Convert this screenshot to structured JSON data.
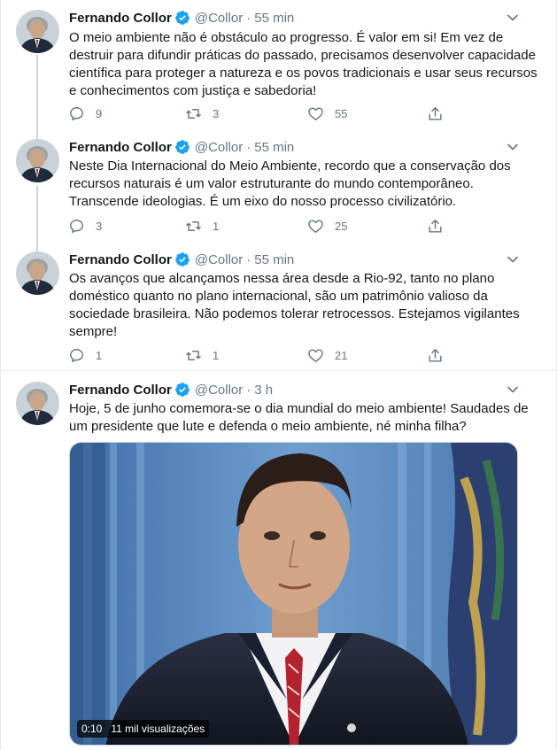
{
  "tweets": [
    {
      "name": "Fernando Collor",
      "handle": "@Collor",
      "dot": "·",
      "time": "55 min",
      "text": "O meio ambiente não é obstáculo ao progresso. É valor em si! Em vez de destruir para difundir práticas do passado, precisamos desenvolver capacidade científica para proteger a natureza e os povos tradicionais e usar seus recursos e conhecimentos com justiça e sabedoria!",
      "replies": "9",
      "retweets": "3",
      "likes": "55"
    },
    {
      "name": "Fernando Collor",
      "handle": "@Collor",
      "dot": "·",
      "time": "55 min",
      "text": "Neste Dia Internacional do Meio Ambiente, recordo que a conservação dos recursos naturais é um valor estruturante do mundo contemporâneo. Transcende ideologias. É um eixo do nosso processo civilizatório.",
      "replies": "3",
      "retweets": "1",
      "likes": "25"
    },
    {
      "name": "Fernando Collor",
      "handle": "@Collor",
      "dot": "·",
      "time": "55 min",
      "text": "Os avanços que alcançamos nessa área desde a Rio-92, tanto no plano doméstico quanto no plano internacional, são um patrimônio valioso da sociedade brasileira. Não podemos tolerar retrocessos. Estejamos vigilantes sempre!",
      "replies": "1",
      "retweets": "1",
      "likes": "21"
    },
    {
      "name": "Fernando Collor",
      "handle": "@Collor",
      "dot": "·",
      "time": "3 h",
      "text": "Hoje, 5 de junho comemora-se o dia mundial do meio ambiente! Saudades de um presidente que lute e defenda o meio ambiente, né minha filha?"
    }
  ],
  "video": {
    "duration": "0:10",
    "views": "11 mil visualizações"
  },
  "colors": {
    "verified": "#1da1f2",
    "secondary_text": "#657786",
    "divider": "#e6ecf0"
  },
  "icons": [
    "verified-badge-icon",
    "chevron-down-icon",
    "reply-icon",
    "retweet-icon",
    "like-icon",
    "share-icon"
  ]
}
